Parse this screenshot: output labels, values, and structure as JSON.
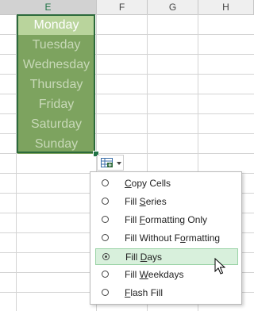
{
  "columns": [
    {
      "letter": "E",
      "selected": true
    },
    {
      "letter": "F",
      "selected": false
    },
    {
      "letter": "G",
      "selected": false
    },
    {
      "letter": "H",
      "selected": false
    }
  ],
  "cells": [
    "Monday",
    "Tuesday",
    "Wednesday",
    "Thursday",
    "Friday",
    "Saturday",
    "Sunday"
  ],
  "autofill_options": {
    "icon": "auto-fill-options-icon",
    "items": [
      {
        "before": "",
        "accel": "C",
        "after": "opy Cells",
        "checked": false
      },
      {
        "before": "Fill ",
        "accel": "S",
        "after": "eries",
        "checked": false
      },
      {
        "before": "Fill ",
        "accel": "F",
        "after": "ormatting Only",
        "checked": false
      },
      {
        "before": "Fill Without F",
        "accel": "o",
        "after": "rmatting",
        "checked": false
      },
      {
        "before": "Fill ",
        "accel": "D",
        "after": "ays",
        "checked": true
      },
      {
        "before": "Fill ",
        "accel": "W",
        "after": "eekdays",
        "checked": false
      },
      {
        "before": "",
        "accel": "F",
        "after": "lash Fill",
        "checked": false
      }
    ]
  },
  "colors": {
    "selection_border": "#2c6a3b",
    "first_cell_fill": "#b9d49c",
    "filled_cells": "#7da35f",
    "menu_highlight": "#d8f0dc"
  }
}
